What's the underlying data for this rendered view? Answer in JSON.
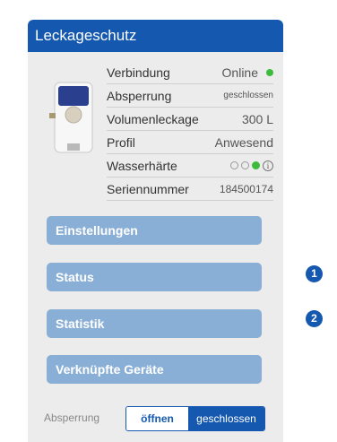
{
  "panel": {
    "title": "Leckageschutz"
  },
  "info_rows": [
    {
      "label": "Verbindung",
      "value": "Online"
    },
    {
      "label": "Absperrung",
      "value": "geschlossen"
    },
    {
      "label": "Volumenleckage",
      "value": "300 L"
    },
    {
      "label": "Profil",
      "value": "Anwesend"
    },
    {
      "label": "Wasserhärte",
      "value": ""
    },
    {
      "label": "Seriennummer",
      "value": "184500174"
    }
  ],
  "buttons": {
    "settings": "Einstellungen",
    "status": "Status",
    "statistics": "Statistik",
    "linked_devices": "Verknüpfte Geräte"
  },
  "markers": {
    "one": "1",
    "two": "2"
  },
  "shutoff": {
    "label": "Absperrung",
    "open": "öffnen",
    "closed": "geschlossen",
    "selected": "geschlossen"
  },
  "colors": {
    "header": "#1558b0",
    "button": "#8aafd6",
    "status_green": "#3dbb3d"
  }
}
